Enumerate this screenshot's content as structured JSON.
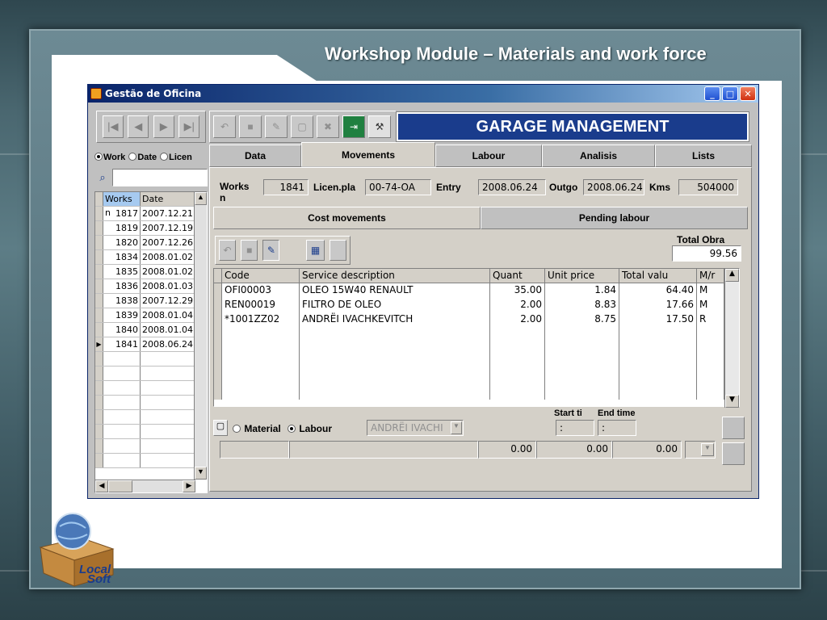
{
  "slide": {
    "title": "Workshop Module – Materials and work force"
  },
  "logo": {
    "text_line1": "Local",
    "text_line2": "Soft"
  },
  "window": {
    "title": "Gestão de Oficina"
  },
  "banner": "GARAGE MANAGEMENT",
  "left": {
    "radios": [
      "Work",
      "Date",
      "Licen"
    ],
    "selected_radio": "Work",
    "headers": [
      "Works n",
      "Date"
    ],
    "rows": [
      {
        "works": "1817",
        "date": "2007.12.21"
      },
      {
        "works": "1819",
        "date": "2007.12.19"
      },
      {
        "works": "1820",
        "date": "2007.12.26"
      },
      {
        "works": "1834",
        "date": "2008.01.02"
      },
      {
        "works": "1835",
        "date": "2008.01.02"
      },
      {
        "works": "1836",
        "date": "2008.01.03"
      },
      {
        "works": "1838",
        "date": "2007.12.29"
      },
      {
        "works": "1839",
        "date": "2008.01.04"
      },
      {
        "works": "1840",
        "date": "2008.01.04"
      },
      {
        "works": "1841",
        "date": "2008.06.24"
      }
    ],
    "current_row": "1841"
  },
  "tabs": [
    "Data",
    "Movements",
    "Labour",
    "Analisis",
    "Lists"
  ],
  "active_tab": "Movements",
  "header_fields": {
    "works_label": "Works n",
    "works_value": "1841",
    "plate_label": "Licen.pla",
    "plate_value": "00-74-OA",
    "entry_label": "Entry",
    "entry_value": "2008.06.24",
    "outgo_label": "Outgo",
    "outgo_value": "2008.06.24",
    "kms_label": "Kms",
    "kms_value": "504000"
  },
  "subtabs": [
    "Cost movements",
    "Pending labour"
  ],
  "active_subtab": "Cost movements",
  "total": {
    "label": "Total Obra",
    "value": "99.56"
  },
  "grid": {
    "headers": [
      "Code",
      "Service description",
      "Quant",
      "Unit price",
      "Total valu",
      "M/r"
    ],
    "rows": [
      {
        "code": "OFI00003",
        "desc": "OLEO 15W40 RENAULT",
        "quant": "35.00",
        "unit": "1.84",
        "total": "64.40",
        "mr": "M"
      },
      {
        "code": "REN00019",
        "desc": "FILTRO DE OLEO",
        "quant": "2.00",
        "unit": "8.83",
        "total": "17.66",
        "mr": "M"
      },
      {
        "code": "*1001ZZ02",
        "desc": "ANDRËI IVACHKEVITCH",
        "quant": "2.00",
        "unit": "8.75",
        "total": "17.50",
        "mr": "R"
      }
    ]
  },
  "bottom": {
    "material_label": "Material",
    "labour_label": "Labour",
    "selected": "Labour",
    "worker_value": "ANDRËI IVACHI",
    "start_label": "Start ti",
    "end_label": "End time",
    "start_value": ":",
    "end_value": ":",
    "quant_value": "0.00",
    "unit_value": "0.00",
    "total_value": "0.00"
  }
}
